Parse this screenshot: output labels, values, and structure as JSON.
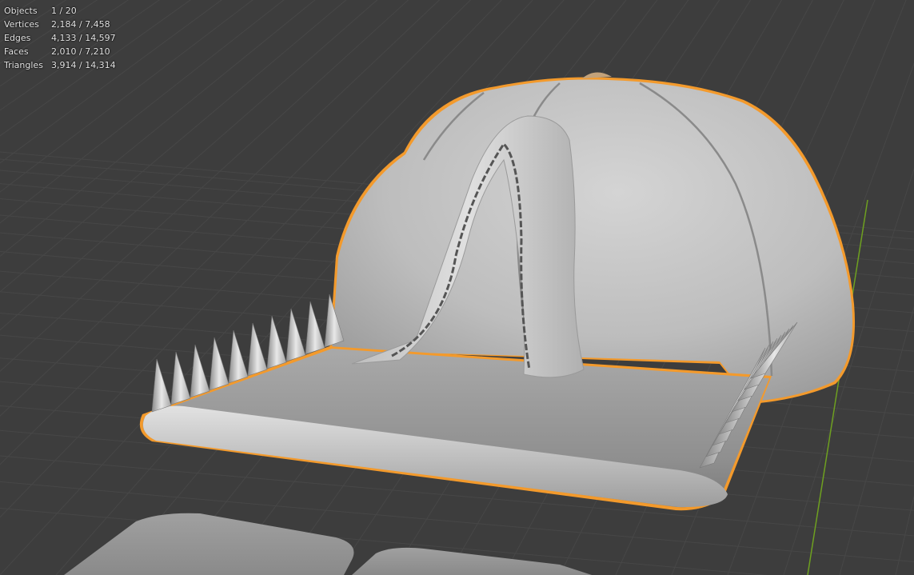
{
  "viewport": {
    "background": "#3d3d3d",
    "grid_color": "#4a4a4a",
    "y_axis_color": "#6ea020",
    "selection_outline": "#f39a2c",
    "mesh_color": "#b8b8b8"
  },
  "stats": [
    {
      "label": "Objects",
      "value": "1 / 20"
    },
    {
      "label": "Vertices",
      "value": "2,184 / 7,458"
    },
    {
      "label": "Edges",
      "value": "4,133 / 14,597"
    },
    {
      "label": "Faces",
      "value": "2,010 / 7,210"
    },
    {
      "label": "Triangles",
      "value": "3,914 / 14,314"
    }
  ]
}
